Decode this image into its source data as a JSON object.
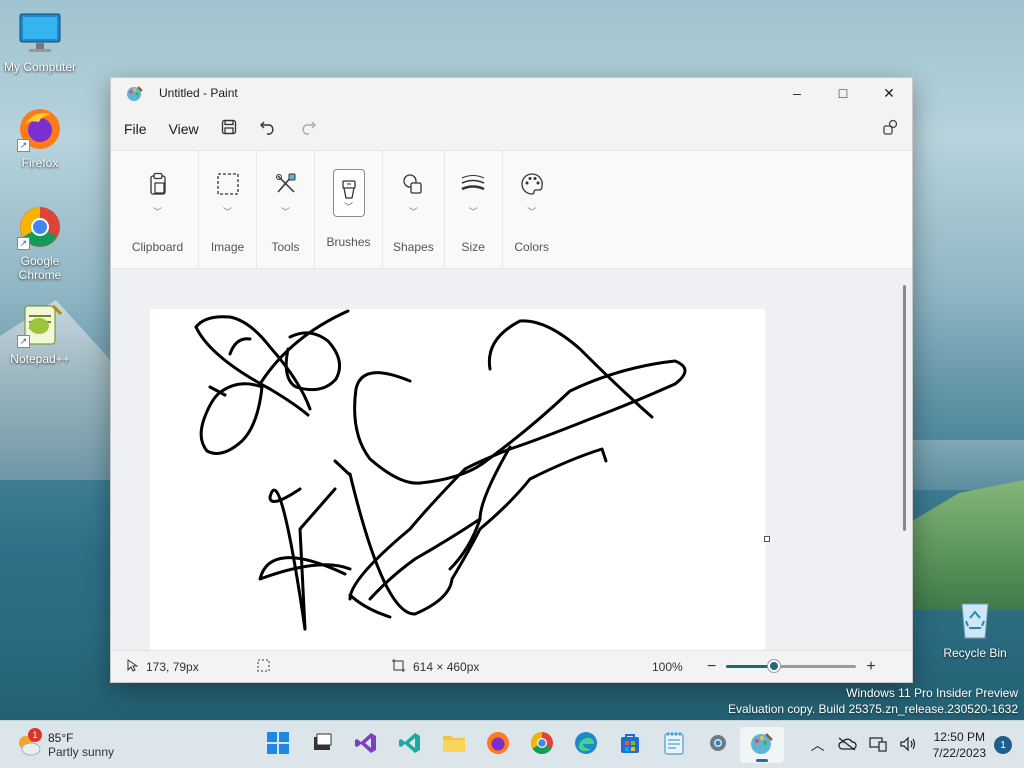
{
  "desktop": {
    "icons": [
      {
        "label": "My Computer"
      },
      {
        "label": "Firefox"
      },
      {
        "label": "Google Chrome"
      },
      {
        "label": "Notepad++"
      },
      {
        "label": "Recycle Bin"
      }
    ],
    "watermark": {
      "line1": "Windows 11 Pro Insider Preview",
      "line2": "Evaluation copy. Build 25375.zn_release.230520-1632"
    }
  },
  "window": {
    "title": "Untitled - Paint",
    "controls": {
      "minimize": "–",
      "maximize": "□",
      "close": "✕"
    },
    "menu": {
      "file": "File",
      "view": "View"
    },
    "ribbon": {
      "groups": [
        {
          "label": "Clipboard",
          "icon": "clipboard-icon"
        },
        {
          "label": "Image",
          "icon": "selection-icon"
        },
        {
          "label": "Tools",
          "icon": "tools-icon"
        },
        {
          "label": "Brushes",
          "icon": "brush-icon"
        },
        {
          "label": "Shapes",
          "icon": "shapes-icon"
        },
        {
          "label": "Size",
          "icon": "size-icon"
        },
        {
          "label": "Colors",
          "icon": "palette-icon"
        }
      ]
    },
    "status": {
      "cursor_pos": "173, 79px",
      "canvas_size": "614 × 460px",
      "zoom": "100%",
      "zoom_level": 0.37
    }
  },
  "taskbar": {
    "weather": {
      "badge": "1",
      "temp": "85°F",
      "condition": "Partly sunny"
    },
    "clock": {
      "time": "12:50 PM",
      "date": "7/22/2023"
    },
    "notifications": "1"
  }
}
